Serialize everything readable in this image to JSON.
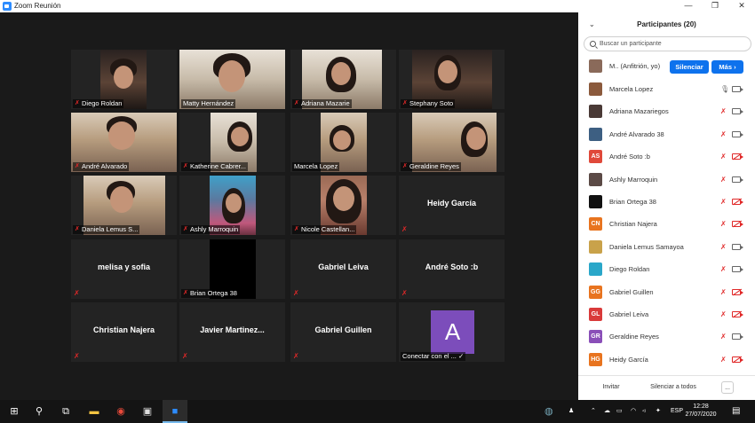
{
  "window": {
    "title": "Zoom Reunión",
    "minimize": "—",
    "restore": "❐",
    "close": "✕"
  },
  "tiles": [
    {
      "name": "Diego Roldan",
      "muted": true
    },
    {
      "name": "Matty Hernández",
      "muted": false,
      "active": true
    },
    {
      "name": "Adriana Mazarie",
      "muted": true
    },
    {
      "name": "Stephany Soto",
      "muted": true
    },
    {
      "name": "André Alvarado",
      "muted": true
    },
    {
      "name": "Katherine Cabrer...",
      "muted": true
    },
    {
      "name": "Marcela Lopez",
      "muted": false
    },
    {
      "name": "Geraldine Reyes",
      "muted": true
    },
    {
      "name": "Daniela Lemus S...",
      "muted": true
    },
    {
      "name": "Ashly Marroquin",
      "muted": true
    },
    {
      "name": "Nicole Castellan...",
      "muted": true
    },
    {
      "name": "Heidy García",
      "muted": true
    },
    {
      "name": "melisa y sofia",
      "muted": true
    },
    {
      "name": "Brian Ortega 38",
      "muted": true
    },
    {
      "name": "Gabriel Leiva",
      "muted": true
    },
    {
      "name": "André Soto :b",
      "muted": true
    },
    {
      "name": "Christian Najera",
      "muted": true
    },
    {
      "name": "Javier  Martinez...",
      "muted": true
    },
    {
      "name": "Gabriel Guillen",
      "muted": true
    },
    {
      "name": "Conectar con el ...",
      "muted": false,
      "avatar": "A"
    }
  ],
  "panel": {
    "title": "Participantes (20)",
    "collapse": "⌄",
    "search_placeholder": "Buscar un participante",
    "me": {
      "name": "M.. (Anfitrión, yo)",
      "mute_btn": "Silenciar",
      "more_btn": "Más ›"
    },
    "participants": [
      {
        "name": "Marcela Lopez",
        "initials": "",
        "color": "#8b5a3c",
        "mic": "on",
        "cam": "on"
      },
      {
        "name": "Adriana Mazariegos",
        "initials": "",
        "color": "#4a3a36",
        "mic": "off",
        "cam": "on"
      },
      {
        "name": "André Alvarado 38",
        "initials": "",
        "color": "#3d5f82",
        "mic": "off",
        "cam": "on"
      },
      {
        "name": "André Soto :b",
        "initials": "AS",
        "color": "#e0493a",
        "mic": "off",
        "cam": "off"
      },
      {
        "name": "Ashly Marroquin",
        "initials": "",
        "color": "#5b4a46",
        "mic": "off",
        "cam": "on"
      },
      {
        "name": "Brian Ortega 38",
        "initials": "",
        "color": "#111111",
        "mic": "off",
        "cam": "off"
      },
      {
        "name": "Christian Najera",
        "initials": "CN",
        "color": "#e8741f",
        "mic": "off",
        "cam": "off"
      },
      {
        "name": "Daniela Lemus Samayoa",
        "initials": "",
        "color": "#c9a24a",
        "mic": "off",
        "cam": "on"
      },
      {
        "name": "Diego Roldan",
        "initials": "",
        "color": "#2aa7c9",
        "mic": "off",
        "cam": "on"
      },
      {
        "name": "Gabriel Guillen",
        "initials": "GG",
        "color": "#e8741f",
        "mic": "off",
        "cam": "off"
      },
      {
        "name": "Gabriel Leiva",
        "initials": "GL",
        "color": "#d93a3a",
        "mic": "off",
        "cam": "off"
      },
      {
        "name": "Geraldine Reyes",
        "initials": "GR",
        "color": "#8a4fb8",
        "mic": "off",
        "cam": "on"
      },
      {
        "name": "Heidy García",
        "initials": "HG",
        "color": "#e8741f",
        "mic": "off",
        "cam": "off"
      }
    ],
    "footer": {
      "invite": "Invitar",
      "mute_all": "Silenciar a todos",
      "more": "..."
    }
  },
  "taskbar": {
    "lang": "ESP",
    "time": "12:28",
    "date": "27/07/2020"
  }
}
